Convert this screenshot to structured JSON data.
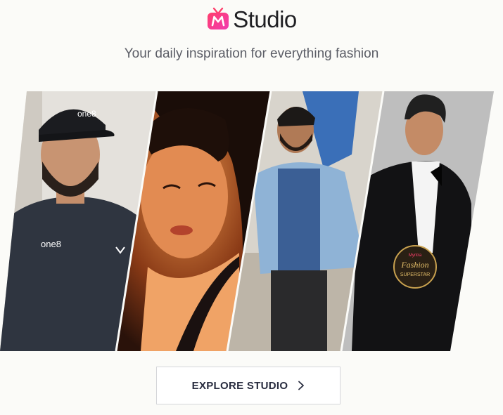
{
  "header": {
    "brand_icon": "myntra-tv-logo-icon",
    "brand_title": "Studio",
    "tagline": "Your daily inspiration for everything fashion"
  },
  "collage": {
    "photos": [
      {
        "name": "photo-man-black-cap",
        "cap_text": "one8",
        "shirt_text": "one8"
      },
      {
        "name": "photo-woman-closeup"
      },
      {
        "name": "photo-man-blue-shirt"
      },
      {
        "name": "photo-man-black-suit",
        "badge_brand": "Myntra",
        "badge_line1": "Fashion",
        "badge_line2": "SUPERSTAR"
      }
    ]
  },
  "cta": {
    "label": "EXPLORE STUDIO",
    "icon": "chevron-right-icon"
  },
  "colors": {
    "brand_gradient_start": "#ff3f6c",
    "brand_gradient_end": "#f13ab1",
    "text_dark": "#1f1f23",
    "text_muted": "#5b5d66",
    "button_border": "#d4d5d9"
  }
}
